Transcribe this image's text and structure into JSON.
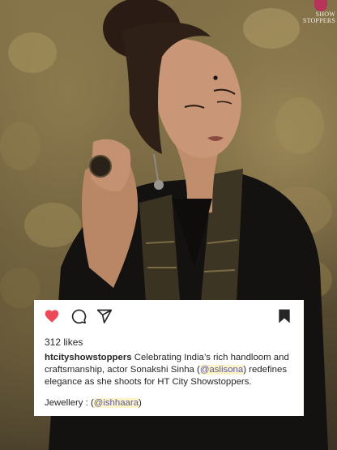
{
  "watermark": {
    "line1": "SHOW",
    "line2": "STOPPERS"
  },
  "post": {
    "likes": "312 likes",
    "username": "htcityshowstoppers",
    "caption_part1": " Celebrating India’s rich handloom and craftsmanship, actor Sonakshi Sinha (",
    "caption_mention": "@aslisona",
    "caption_part2": ") redefines elegance as she shoots for HT City Showstoppers.",
    "credit_label": "Jewellery : (",
    "credit_mention": "@ishhaara",
    "credit_close": ")"
  },
  "icons": {
    "like": "heart-icon",
    "comment": "comment-icon",
    "share": "share-icon",
    "save": "bookmark-icon"
  },
  "colors": {
    "like": "#ed4956",
    "text": "#262626",
    "mention_highlight": "#fdf4c8",
    "card": "#ffffff"
  }
}
